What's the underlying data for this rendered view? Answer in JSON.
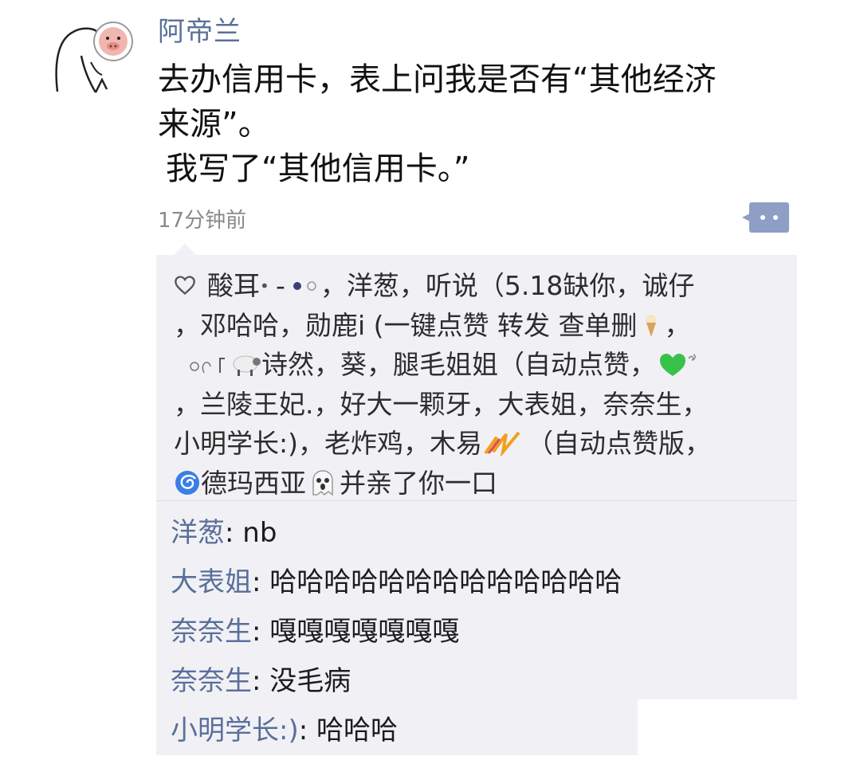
{
  "post": {
    "author": "阿帝兰",
    "text_lines": [
      "去办信用卡，表上问我是否有“其他经济",
      "来源”。",
      "我写了“其他信用卡。”"
    ],
    "timestamp": "17分钟前"
  },
  "likes": {
    "lines": [
      [
        "酸耳",
        "-",
        "，洋葱，听说（5.18缺你，诚仔"
      ],
      [
        "，邓哈哈，勋鹿i (一键点赞 转发 查单删",
        "，"
      ],
      [
        "诗然，葵，腿毛姐姐（自动点赞，"
      ],
      [
        "，兰陵王妃.，好大一颗牙，大表姐，奈奈生，"
      ],
      [
        "小明学长:)，老炸鸡，木易",
        "（自动点赞版，"
      ],
      [
        "德玛西亚",
        "并亲了你一口"
      ]
    ]
  },
  "comments": [
    {
      "author": "洋葱",
      "text": "nb"
    },
    {
      "author": "大表姐",
      "text": "哈哈哈哈哈哈哈哈哈哈哈哈哈"
    },
    {
      "author": "奈奈生",
      "text": "嘎嘎嘎嘎嘎嘎嘎"
    },
    {
      "author": "奈奈生",
      "text": "没毛病"
    },
    {
      "author": "小明学长:)",
      "text": "哈哈哈"
    }
  ],
  "separator": ": ",
  "colors": {
    "name_link": "#5a6f9a",
    "comment_bg": "#f1f1f5",
    "comment_button": "#8d9fc4",
    "timestamp": "#8a8a8a"
  },
  "icons": [
    "avatar-sketch-pig",
    "comment-dots-icon",
    "heart-outline-icon",
    "ice-cream-icon",
    "sheep-icon",
    "green-heart-icon",
    "swoosh-icon",
    "cyclone-icon",
    "ghost-icon"
  ]
}
